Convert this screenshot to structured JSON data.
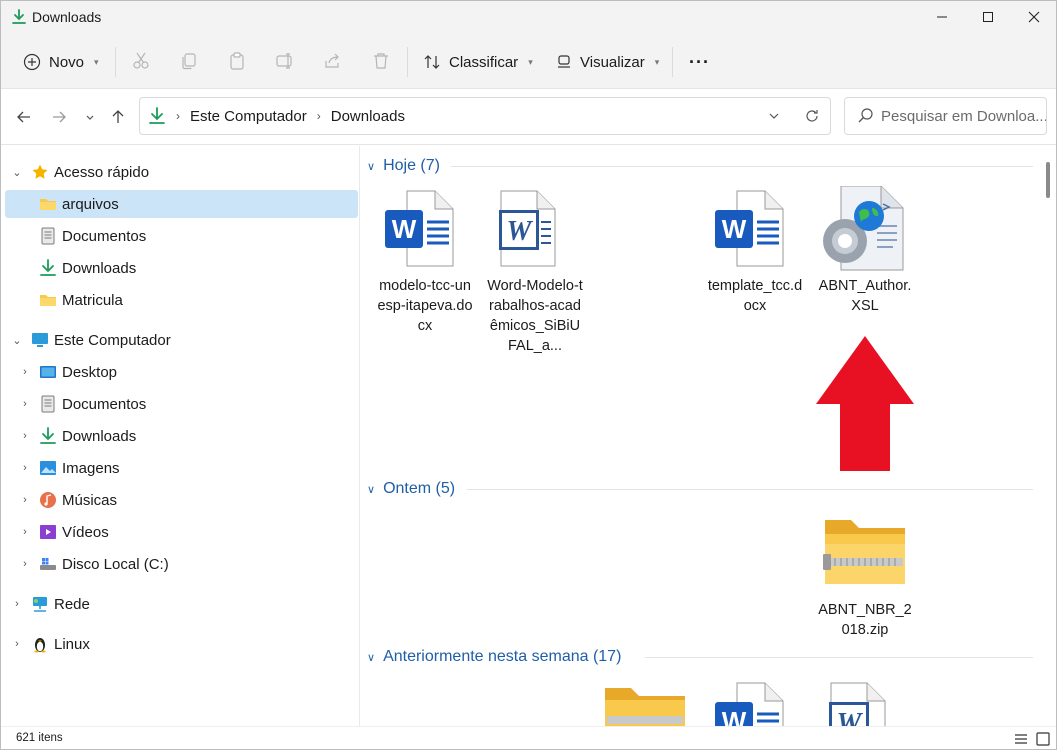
{
  "window": {
    "title": "Downloads",
    "controls": {
      "minimize": "─",
      "maximize": "☐",
      "close": "✕"
    }
  },
  "toolbar": {
    "new_label": "Novo",
    "sort_label": "Classificar",
    "view_label": "Visualizar",
    "more_label": "···"
  },
  "address": {
    "segments": [
      "Este Computador",
      "Downloads"
    ],
    "search_placeholder": "Pesquisar em Downloa..."
  },
  "sidebar": {
    "quick_access": "Acesso rápido",
    "quick_items": [
      "arquivos",
      "Documentos",
      "Downloads",
      "Matricula"
    ],
    "this_pc": "Este Computador",
    "pc_items": [
      "Desktop",
      "Documentos",
      "Downloads",
      "Imagens",
      "Músicas",
      "Vídeos",
      "Disco Local (C:)"
    ],
    "network": "Rede",
    "linux": "Linux"
  },
  "groups": {
    "today": "Hoje (7)",
    "yesterday": "Ontem (5)",
    "earlier": "Anteriormente nesta semana (17)"
  },
  "files": {
    "f1": "modelo-tcc-unesp-itapeva.docx",
    "f2": "Word-Modelo-trabalhos-acadêmicos_SiBiUFAL_a...",
    "f3": "template_tcc.docx",
    "f4": "ABNT_Author.XSL",
    "f5": "ABNT_NBR_2018.zip"
  },
  "status": {
    "item_count": "621 itens"
  },
  "colors": {
    "accent": "#1f5ea8",
    "selection": "#cce4f7",
    "word_blue": "#185abd",
    "folder_yellow": "#f8c94a",
    "annotation_red": "#e81123"
  }
}
